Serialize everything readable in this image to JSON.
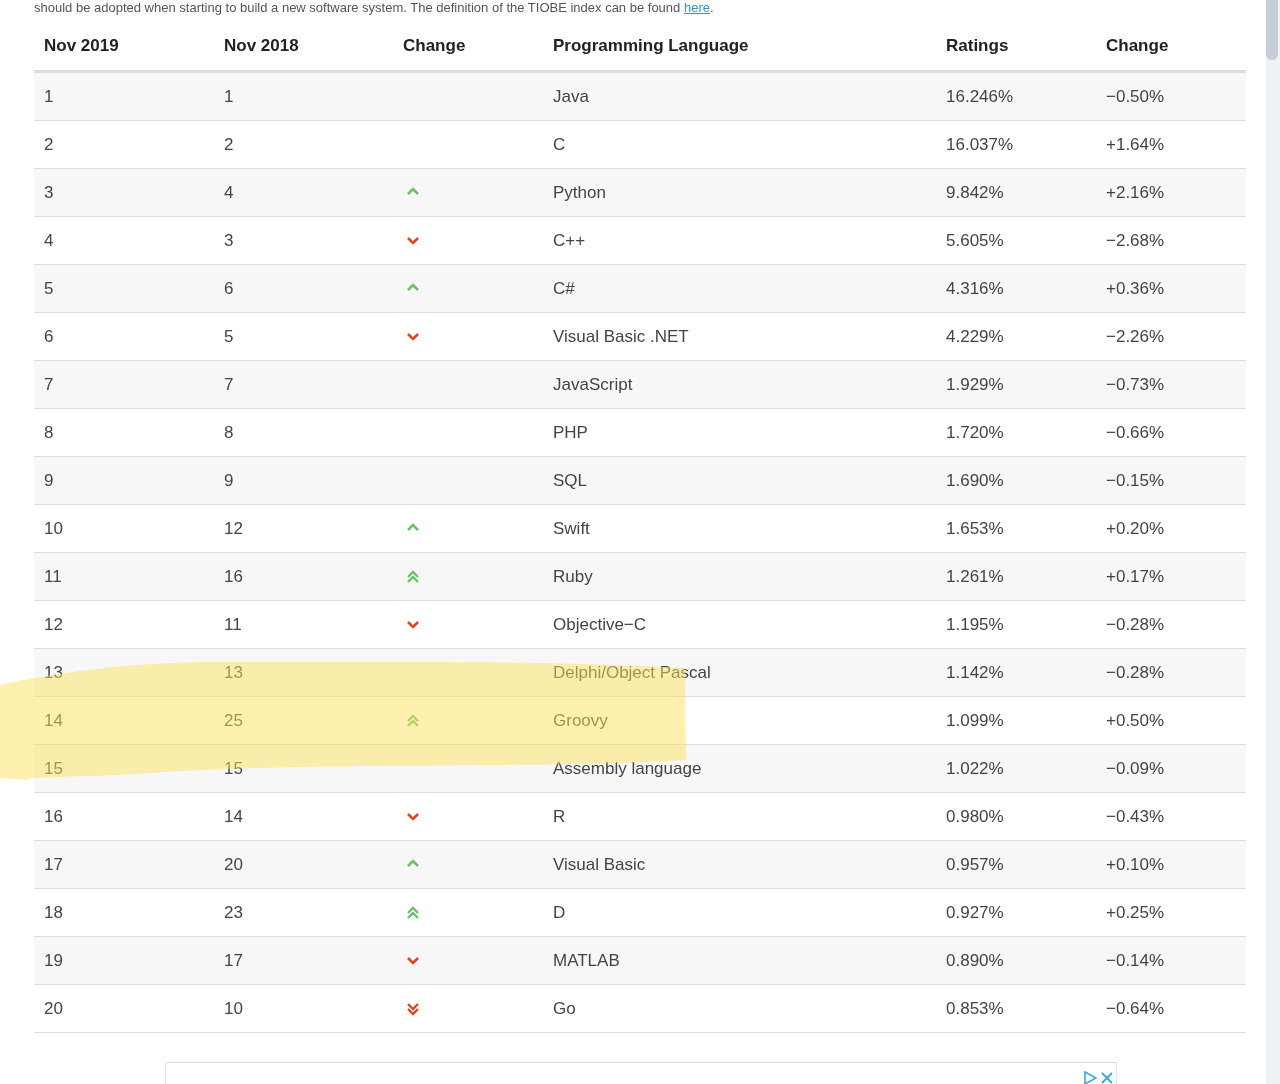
{
  "intro": {
    "text": "should be adopted when starting to build a new software system. The definition of the TIOBE index can be found ",
    "link": "here",
    "after": "."
  },
  "table": {
    "columns": [
      "Nov 2019",
      "Nov 2018",
      "Change",
      "Programming Language",
      "Ratings",
      "Change"
    ],
    "rows": [
      {
        "rank": "1",
        "prev": "1",
        "kind": "none",
        "language": "Java",
        "rating": "16.246%",
        "change": "−0.50%"
      },
      {
        "rank": "2",
        "prev": "2",
        "kind": "none",
        "language": "C",
        "rating": "16.037%",
        "change": "+1.64%"
      },
      {
        "rank": "3",
        "prev": "4",
        "kind": "up",
        "language": "Python",
        "rating": "9.842%",
        "change": "+2.16%"
      },
      {
        "rank": "4",
        "prev": "3",
        "kind": "down",
        "language": "C++",
        "rating": "5.605%",
        "change": "−2.68%"
      },
      {
        "rank": "5",
        "prev": "6",
        "kind": "up",
        "language": "C#",
        "rating": "4.316%",
        "change": "+0.36%"
      },
      {
        "rank": "6",
        "prev": "5",
        "kind": "down",
        "language": "Visual Basic .NET",
        "rating": "4.229%",
        "change": "−2.26%"
      },
      {
        "rank": "7",
        "prev": "7",
        "kind": "none",
        "language": "JavaScript",
        "rating": "1.929%",
        "change": "−0.73%"
      },
      {
        "rank": "8",
        "prev": "8",
        "kind": "none",
        "language": "PHP",
        "rating": "1.720%",
        "change": "−0.66%"
      },
      {
        "rank": "9",
        "prev": "9",
        "kind": "none",
        "language": "SQL",
        "rating": "1.690%",
        "change": "−0.15%"
      },
      {
        "rank": "10",
        "prev": "12",
        "kind": "up",
        "language": "Swift",
        "rating": "1.653%",
        "change": "+0.20%"
      },
      {
        "rank": "11",
        "prev": "16",
        "kind": "upup",
        "language": "Ruby",
        "rating": "1.261%",
        "change": "+0.17%"
      },
      {
        "rank": "12",
        "prev": "11",
        "kind": "down",
        "language": "Objective−C",
        "rating": "1.195%",
        "change": "−0.28%"
      },
      {
        "rank": "13",
        "prev": "13",
        "kind": "none",
        "language": "Delphi/Object Pascal",
        "rating": "1.142%",
        "change": "−0.28%"
      },
      {
        "rank": "14",
        "prev": "25",
        "kind": "upup",
        "language": "Groovy",
        "rating": "1.099%",
        "change": "+0.50%"
      },
      {
        "rank": "15",
        "prev": "15",
        "kind": "none",
        "language": "Assembly language",
        "rating": "1.022%",
        "change": "−0.09%"
      },
      {
        "rank": "16",
        "prev": "14",
        "kind": "down",
        "language": "R",
        "rating": "0.980%",
        "change": "−0.43%"
      },
      {
        "rank": "17",
        "prev": "20",
        "kind": "up",
        "language": "Visual Basic",
        "rating": "0.957%",
        "change": "+0.10%"
      },
      {
        "rank": "18",
        "prev": "23",
        "kind": "upup",
        "language": "D",
        "rating": "0.927%",
        "change": "+0.25%"
      },
      {
        "rank": "19",
        "prev": "17",
        "kind": "down",
        "language": "MATLAB",
        "rating": "0.890%",
        "change": "−0.14%"
      },
      {
        "rank": "20",
        "prev": "10",
        "kind": "downdown",
        "language": "Go",
        "rating": "0.853%",
        "change": "−0.64%"
      }
    ]
  }
}
